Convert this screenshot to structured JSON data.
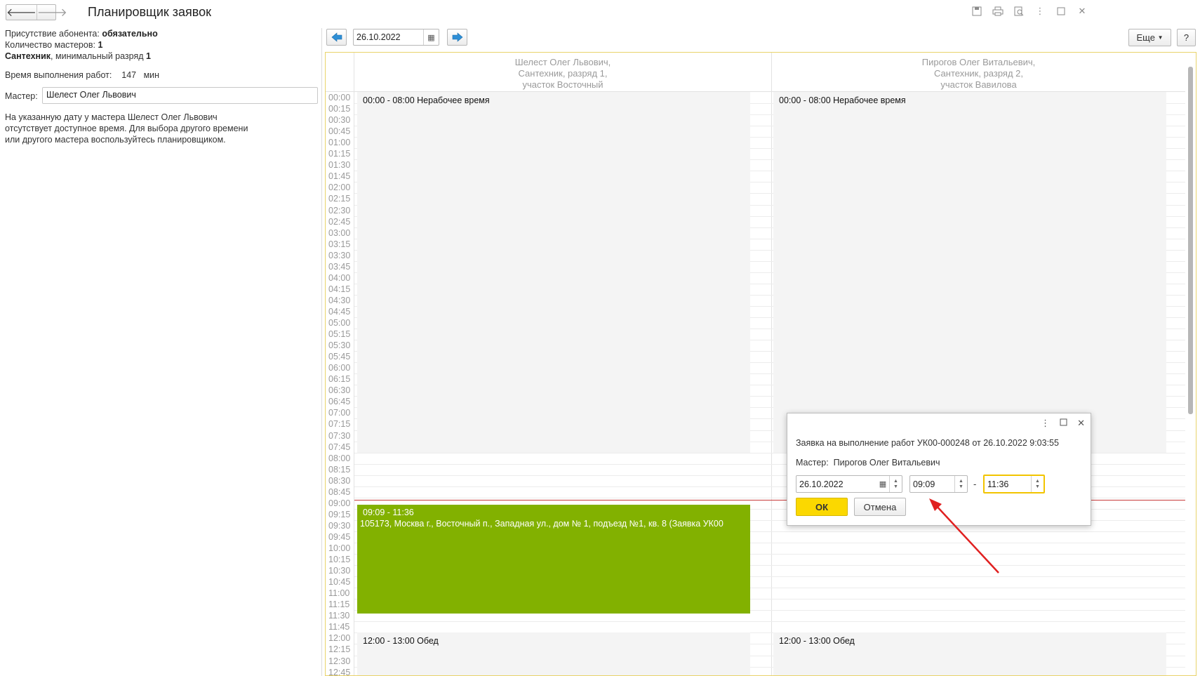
{
  "window": {
    "title": "Планировщик заявок",
    "back_icon": "arrow-left-icon",
    "forward_icon": "arrow-right-icon",
    "back_glyph": "🡐",
    "forward_glyph": "🡒"
  },
  "left_panel": {
    "presence_label": "Присутствие абонента:",
    "presence_value": "обязательно",
    "masters_count_label": "Количество мастеров:",
    "masters_count_value": "1",
    "specialty": "Сантехник",
    "min_grade_label": ", минимальный разряд",
    "min_grade_value": "1",
    "work_time_label": "Время выполнения работ:",
    "work_time_value": "147",
    "work_time_unit": "мин",
    "master_label": "Мастер:",
    "master_value": "Шелест Олег Львович",
    "note_line1": "На указанную дату у мастера Шелест Олег Львович",
    "note_line2": "отсутствует доступное время. Для выбора другого времени",
    "note_line3": "или другого мастера воспользуйтесь планировщиком."
  },
  "toolbar": {
    "date": "26.10.2022",
    "more_label": "Еще",
    "help_label": "?"
  },
  "planner": {
    "columns": [
      {
        "line1": "Шелест Олег Львович,",
        "line2": "Сантехник, разряд 1,",
        "line3": "участок Восточный"
      },
      {
        "line1": "Пирогов Олег Витальевич,",
        "line2": "Сантехник, разряд 2,",
        "line3": "участок Вавилова"
      }
    ],
    "times": [
      "00:00",
      "00:15",
      "00:30",
      "00:45",
      "01:00",
      "01:15",
      "01:30",
      "01:45",
      "02:00",
      "02:15",
      "02:30",
      "02:45",
      "03:00",
      "03:15",
      "03:30",
      "03:45",
      "04:00",
      "04:15",
      "04:30",
      "04:45",
      "05:00",
      "05:15",
      "05:30",
      "05:45",
      "06:00",
      "06:15",
      "06:30",
      "06:45",
      "07:00",
      "07:15",
      "07:30",
      "07:45",
      "08:00",
      "08:15",
      "08:30",
      "08:45",
      "09:00",
      "09:15",
      "09:30",
      "09:45",
      "10:00",
      "10:15",
      "10:30",
      "10:45",
      "11:00",
      "11:15",
      "11:30",
      "11:45",
      "12:00",
      "12:15",
      "12:30",
      "12:45"
    ],
    "nonwork_label": "00:00 - 08:00 Нерабочее время",
    "lunch_label": "12:00 - 13:00 Обед",
    "booking_time": "09:09 - 11:36",
    "booking_address": "105173, Москва г., Восточный п., Западная ул., дом № 1, подъезд №1, кв. 8 (Заявка УК00"
  },
  "dialog": {
    "title": "Заявка на выполнение работ УК00-000248 от 26.10.2022 9:03:55",
    "master_label": "Мастер:",
    "master_value": "Пирогов Олег Витальевич",
    "date": "26.10.2022",
    "time_from": "09:09",
    "dash": "-",
    "time_to": "11:36",
    "ok_label": "ОК",
    "cancel_label": "Отмена"
  },
  "colors": {
    "accent_yellow": "#fbd800",
    "booking_green": "#82b100",
    "current_time_line": "#c83a3a",
    "annotation_arrow": "#e02020"
  }
}
